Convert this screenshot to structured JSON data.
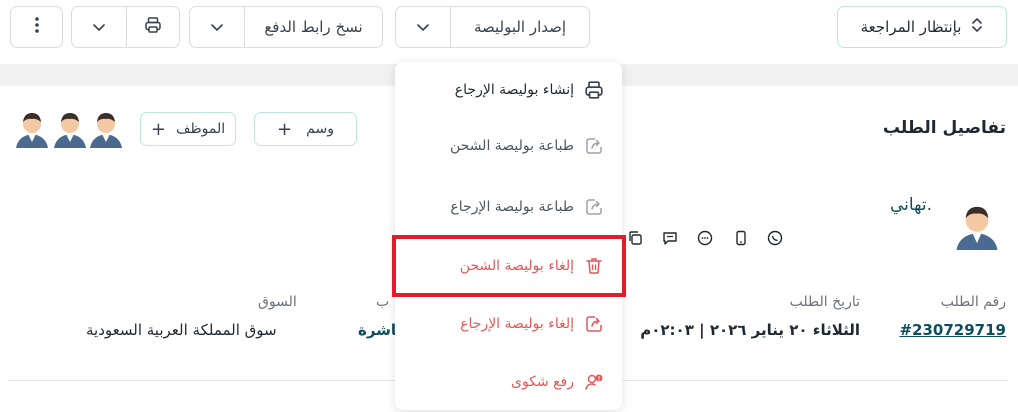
{
  "toolbar": {
    "status_label": "بإنتظار المراجعة",
    "issue_policy_label": "إصدار البوليصة",
    "copy_payment_link_label": "نسخ رابط الدفع"
  },
  "order": {
    "section_title": "تفاصيل الطلب",
    "tag_label": "وسم",
    "employee_label": "الموظف",
    "customer_name": "تهاني.",
    "fields": [
      {
        "label": "رقم الطلب",
        "value": "#230729719"
      },
      {
        "label": "تاريخ الطلب",
        "value": "الثلاثاء ٢٠ يناير ٢٠٢٦ | ٠٢:٠٣م"
      },
      {
        "label": "ب",
        "value": "باشرة"
      },
      {
        "label": "السوق",
        "value": "سوق المملكة العربية السعودية"
      }
    ]
  },
  "menu": {
    "items": [
      {
        "label": "إنشاء بوليصة الإرجاع",
        "icon": "printer-icon",
        "color": "#1f2933"
      },
      {
        "label": "طباعة بوليصة الشحن",
        "icon": "share-icon",
        "color": "#4b5563"
      },
      {
        "label": "طباعة بوليصة الإرجاع",
        "icon": "share-icon",
        "color": "#4b5563"
      },
      {
        "label": "إلغاء بوليصة الشحن",
        "icon": "trash-icon",
        "color": "#e05a5a"
      },
      {
        "label": "إلغاء بوليصة الإرجاع",
        "icon": "share-icon",
        "color": "#e05a5a"
      },
      {
        "label": "رفع شكوى",
        "icon": "user-alert-icon",
        "color": "#e05a5a"
      }
    ]
  },
  "colors": {
    "accent_teal": "#bfe6de",
    "danger": "#e05a5a",
    "highlight": "#e11d2a"
  }
}
